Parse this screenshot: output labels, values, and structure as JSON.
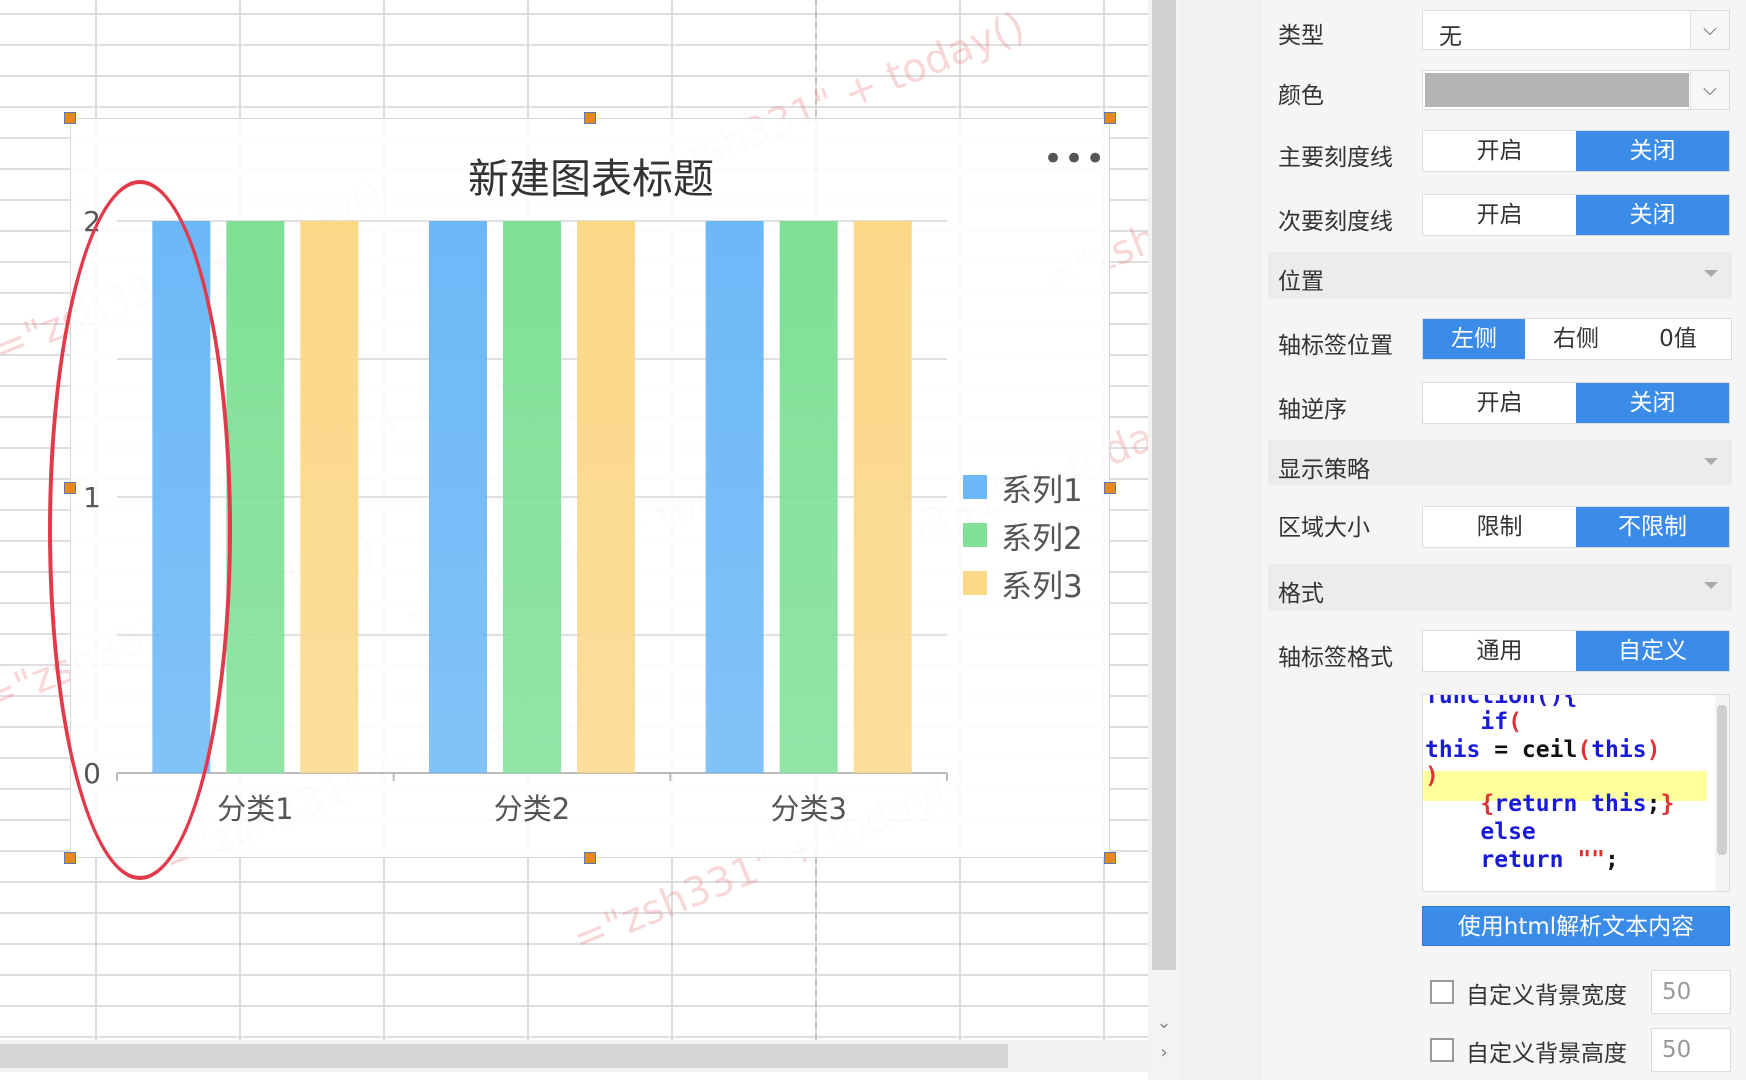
{
  "chart": {
    "title": "新建图表标题",
    "menu_icon": "ellipsis-icon",
    "chart_data": {
      "type": "bar",
      "title": "新建图表标题",
      "categories": [
        "分类1",
        "分类2",
        "分类3"
      ],
      "series": [
        {
          "name": "系列1",
          "values": [
            2,
            2,
            2
          ],
          "color": "#6cb8f7"
        },
        {
          "name": "系列2",
          "values": [
            2,
            2,
            2
          ],
          "color": "#7fe096"
        },
        {
          "name": "系列3",
          "values": [
            2,
            2,
            2
          ],
          "color": "#fbd888"
        }
      ],
      "y_ticks": [
        "0",
        "1",
        "2"
      ],
      "ylim": [
        0,
        2
      ],
      "grid": true,
      "legend": "right"
    }
  },
  "watermark_text": "=\"zsh331\" + today()",
  "panel": {
    "type": {
      "label": "类型",
      "value": "无"
    },
    "color": {
      "label": "颜色",
      "value": "#b3b3b3"
    },
    "major_tick": {
      "label": "主要刻度线",
      "options": [
        "开启",
        "关闭"
      ],
      "active": 1
    },
    "minor_tick": {
      "label": "次要刻度线",
      "options": [
        "开启",
        "关闭"
      ],
      "active": 1
    },
    "position_section": "位置",
    "axis_label_pos": {
      "label": "轴标签位置",
      "options": [
        "左侧",
        "右侧",
        "0值"
      ],
      "active": 0
    },
    "axis_reverse": {
      "label": "轴逆序",
      "options": [
        "开启",
        "关闭"
      ],
      "active": 1
    },
    "display_section": "显示策略",
    "region_size": {
      "label": "区域大小",
      "options": [
        "限制",
        "不限制"
      ],
      "active": 1
    },
    "format_section": "格式",
    "axis_label_format": {
      "label": "轴标签格式",
      "options": [
        "通用",
        "自定义"
      ],
      "active": 1
    },
    "code_lines": [
      [
        [
          "function(){",
          "kw"
        ]
      ],
      [
        [
          "    if",
          "kw"
        ],
        [
          "(",
          "pn"
        ]
      ],
      [
        [
          "this",
          "kw"
        ],
        [
          " = ceil",
          "tx"
        ],
        [
          "(",
          "pn"
        ],
        [
          "this",
          "kw"
        ],
        [
          ")",
          "pn"
        ]
      ],
      [
        [
          ")",
          "pn"
        ]
      ],
      [
        [
          "    ",
          "tx"
        ],
        [
          "{",
          "pn"
        ],
        [
          "return this",
          "kw"
        ],
        [
          ";",
          "tx"
        ],
        [
          "}",
          "pn"
        ]
      ],
      [
        [
          "    else",
          "kw"
        ]
      ],
      [
        [
          "    return ",
          "kw"
        ],
        [
          "\"\"",
          "pn"
        ],
        [
          ";",
          "tx"
        ]
      ]
    ],
    "html_button": "使用html解析文本内容",
    "bg_width": {
      "label": "自定义背景宽度",
      "value": "50"
    },
    "bg_height": {
      "label": "自定义背景高度",
      "value": "50"
    }
  }
}
